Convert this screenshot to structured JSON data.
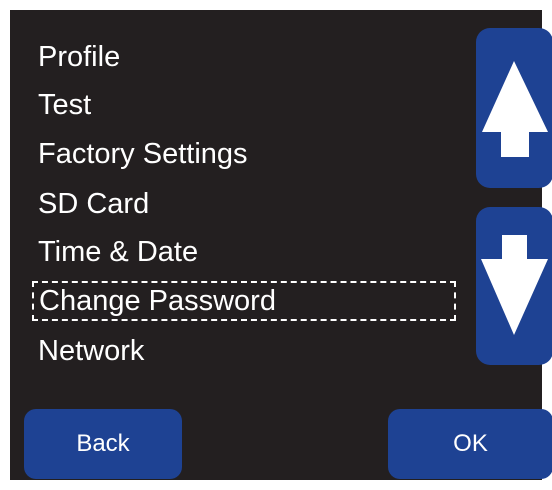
{
  "menu": {
    "items": [
      {
        "label": "Profile"
      },
      {
        "label": "Test"
      },
      {
        "label": "Factory Settings"
      },
      {
        "label": "SD Card"
      },
      {
        "label": "Time & Date"
      },
      {
        "label": "Change Password",
        "selected": true
      },
      {
        "label": "Network"
      }
    ]
  },
  "scroll": {
    "up_icon": "arrow-up-icon",
    "down_icon": "arrow-down-icon"
  },
  "buttons": {
    "back_label": "Back",
    "ok_label": "OK"
  },
  "colors": {
    "background": "#231f20",
    "button": "#1e4293",
    "text": "#ffffff"
  }
}
